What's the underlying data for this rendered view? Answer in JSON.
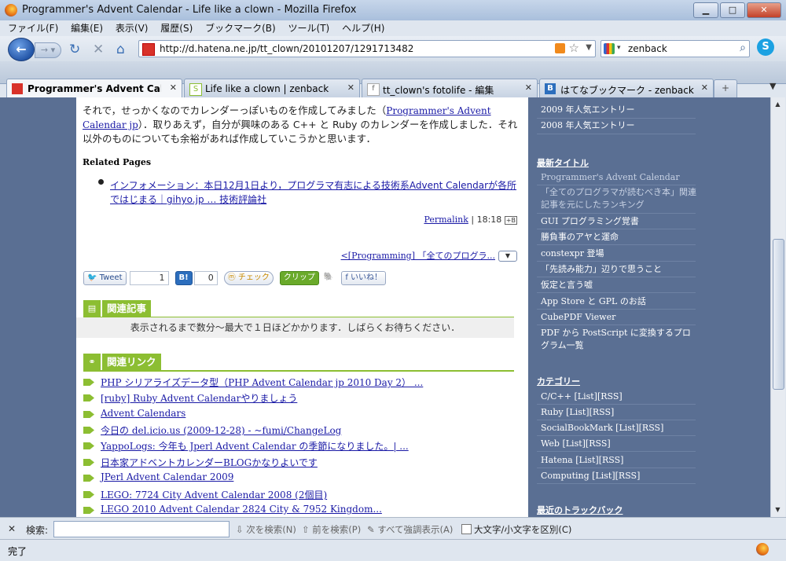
{
  "window": {
    "title": "Programmer's Advent Calendar - Life like a clown - Mozilla Firefox"
  },
  "menu": [
    "ファイル(F)",
    "編集(E)",
    "表示(V)",
    "履歴(S)",
    "ブックマーク(B)",
    "ツール(T)",
    "ヘルプ(H)"
  ],
  "nav": {
    "url": "http://d.hatena.ne.jp/tt_clown/20101207/1291713482",
    "search_value": "zenback"
  },
  "tabs": [
    {
      "label": "Programmer's Advent Calen...",
      "active": true
    },
    {
      "label": "Life like a clown | zenback",
      "active": false
    },
    {
      "label": "tt_clown's fotolife - 編集",
      "active": false
    },
    {
      "label": "はてなブックマーク - zenback",
      "active": false
    }
  ],
  "article": {
    "para_a": "それで，せっかくなのでカレンダーっぽいものを作成してみました（",
    "para_link": "Programmer's Advent Calendar jp",
    "para_b": "）．取りあえず，自分が興味のある C++ と Ruby のカレンダーを作成しました．それ以外のものについても余裕があれば作成していこうかと思います．",
    "related_title": "Related Pages",
    "related_link": "インフォメーション：本日12月1日より，プログラマ有志による技術系Advent Calendarが各所ではじまる｜gihyo.jp … 技術評論社",
    "permalink": "Permalink",
    "time": "| 18:18",
    "prev_link": "<[Programming] 「全てのプログラ..."
  },
  "social": {
    "tweet": "Tweet",
    "tweet_count": "1",
    "hatena_count": "0",
    "check": "チェック",
    "clip": "クリップ",
    "like": "いいね！"
  },
  "related_articles": {
    "heading": "関連記事",
    "notice": "表示されるまで数分〜最大で１日ほどかかります．しばらくお待ちください．"
  },
  "related_links": {
    "heading": "関連リンク",
    "items": [
      "PHP シリアライズデータ型（PHP Advent Calendar jp 2010 Day 2） ...",
      "[ruby] Ruby Advent Calendarやりましょう",
      "Advent Calendars",
      "今日の del.icio.us (2009-12-28) - ~fumi/ChangeLog",
      "YappoLogs: 今年も Jperl Advent Calendar の季節になりました。| ...",
      "日本家アドベントカレンダーBLOGかなりよいです",
      "JPerl Advent Calendar 2009",
      "LEGO: 7724 City Advent Calendar 2008 (2個目)",
      "LEGO 2010 Advent Calendar 2824 City & 7952 Kingdom..."
    ]
  },
  "sidebar": {
    "popular": [
      "2009 年人気エントリー",
      "2008 年人気エントリー"
    ],
    "recent_heading": "最新タイトル",
    "recent": [
      "Programmer's Advent Calendar",
      "「全てのプログラマが読むべき本」関連記事を元にしたランキング",
      "GUI プログラミング覚書",
      "勝負事のアヤと運命",
      "constexpr 登場",
      "「先読み能力」辺りで思うこと",
      "仮定と言う嘘",
      "App Store と GPL のお話",
      "CubePDF Viewer",
      "PDF から PostScript に変換するプログラム一覧"
    ],
    "category_heading": "カテゴリー",
    "categories": [
      "C/C++ [List][RSS]",
      "Ruby [List][RSS]",
      "SocialBookMark [List][RSS]",
      "Web [List][RSS]",
      "Hatena [List][RSS]",
      "Computing [List][RSS]"
    ],
    "trackback_heading": "最近のトラックバック"
  },
  "findbar": {
    "label": "検索:",
    "next": "次を検索(N)",
    "prev": "前を検索(P)",
    "highlight": "すべて強調表示(A)",
    "matchcase": "大文字/小文字を区別(C)"
  },
  "status": {
    "text": "完了"
  }
}
